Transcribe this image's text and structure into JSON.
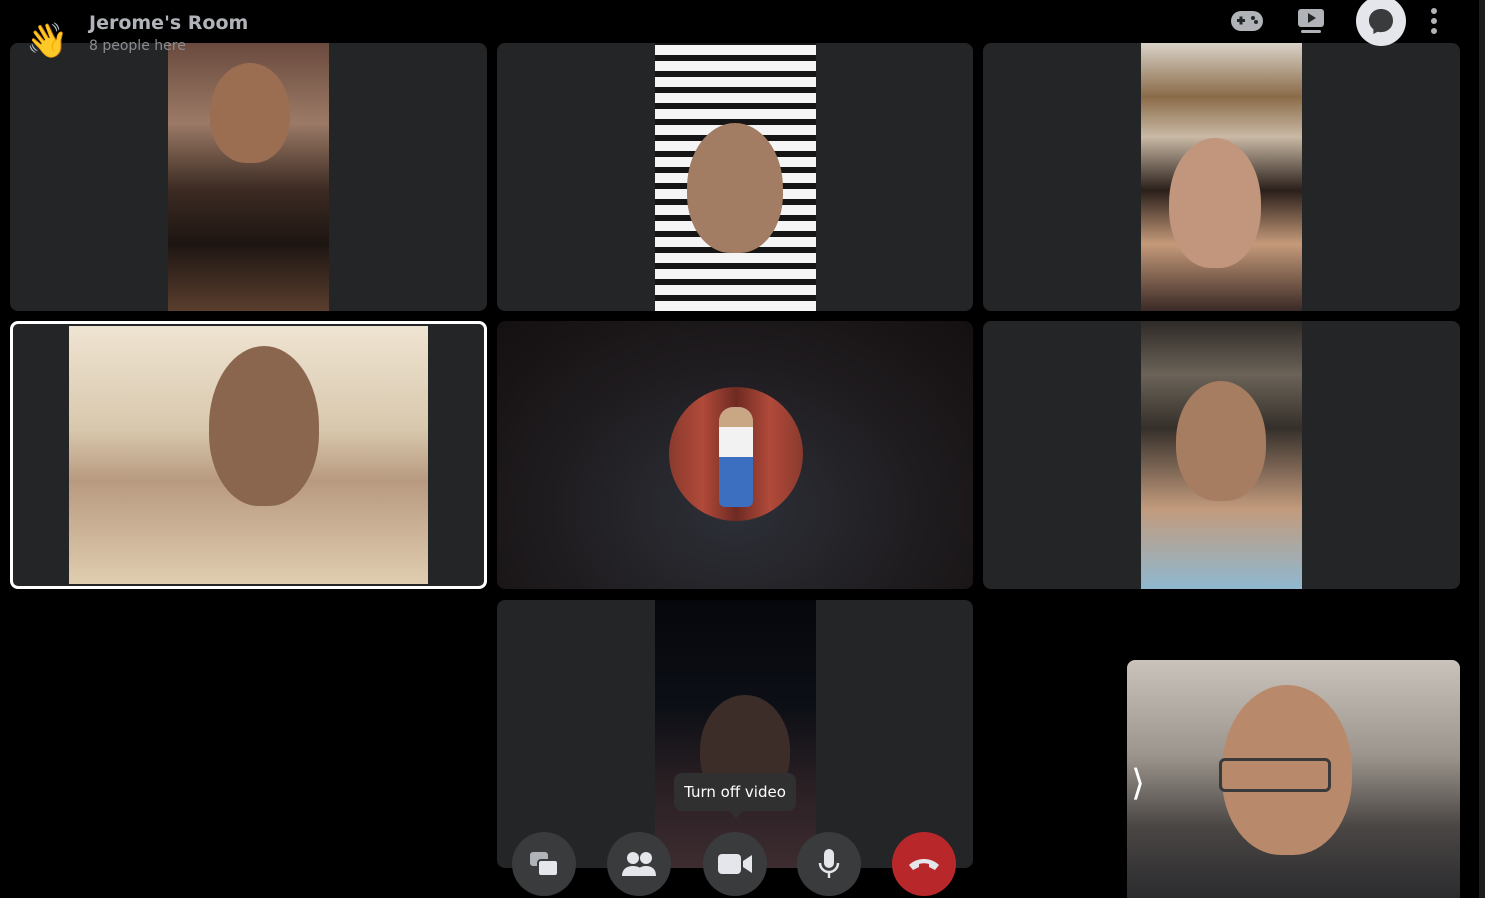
{
  "room": {
    "title": "Jerome's Room",
    "subtitle": "8 people here",
    "wave_icon": "👋"
  },
  "top_toolbar": {
    "icons": [
      "game-controller-icon",
      "watch-together-icon",
      "chat-bubble-icon",
      "more-options-icon"
    ]
  },
  "participants": [
    {
      "tile": 1,
      "video": "on"
    },
    {
      "tile": 2,
      "video": "on"
    },
    {
      "tile": 3,
      "video": "on"
    },
    {
      "tile": 4,
      "video": "on",
      "active_speaker": true
    },
    {
      "tile": 5,
      "video": "off",
      "shows": "profile-picture"
    },
    {
      "tile": 6,
      "video": "on"
    },
    {
      "tile": 7,
      "video": "on"
    }
  ],
  "self_view": {
    "video": "on",
    "expand_glyph": "⟩"
  },
  "tooltip": {
    "text": "Turn off video"
  },
  "controls": {
    "icons": [
      "share-screen-icon",
      "participants-icon",
      "video-camera-icon",
      "microphone-icon",
      "end-call-icon"
    ],
    "colors": {
      "button": "#3a3b3c",
      "end_call": "#b8282a"
    }
  }
}
